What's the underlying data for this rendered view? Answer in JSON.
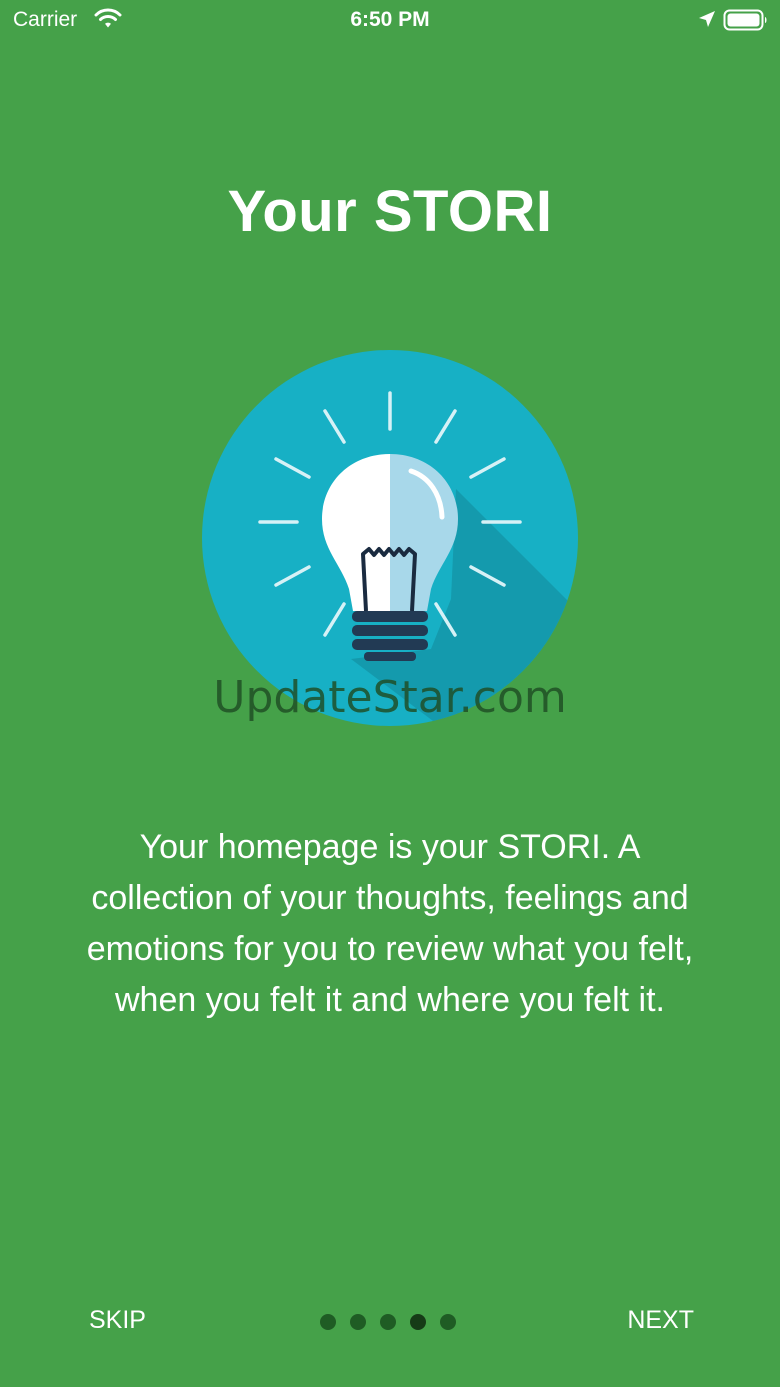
{
  "status_bar": {
    "carrier": "Carrier",
    "time": "6:50 PM",
    "icons": [
      "wifi-icon",
      "location-icon",
      "battery-icon"
    ]
  },
  "onboarding": {
    "title": "Your STORI",
    "illustration": "lightbulb-icon",
    "watermark": "UpdateStar.com",
    "description_lines": [
      "Your homepage is your STORI. A",
      "collection of your thoughts, feelings and",
      "emotions for you to review what you felt,",
      "when you felt it and where you felt it."
    ]
  },
  "navigation": {
    "skip_label": "SKIP",
    "next_label": "NEXT",
    "page_count": 5,
    "current_page": 4
  },
  "colors": {
    "background": "#45a149",
    "circle": "#17b0c5",
    "text": "#ffffff"
  }
}
